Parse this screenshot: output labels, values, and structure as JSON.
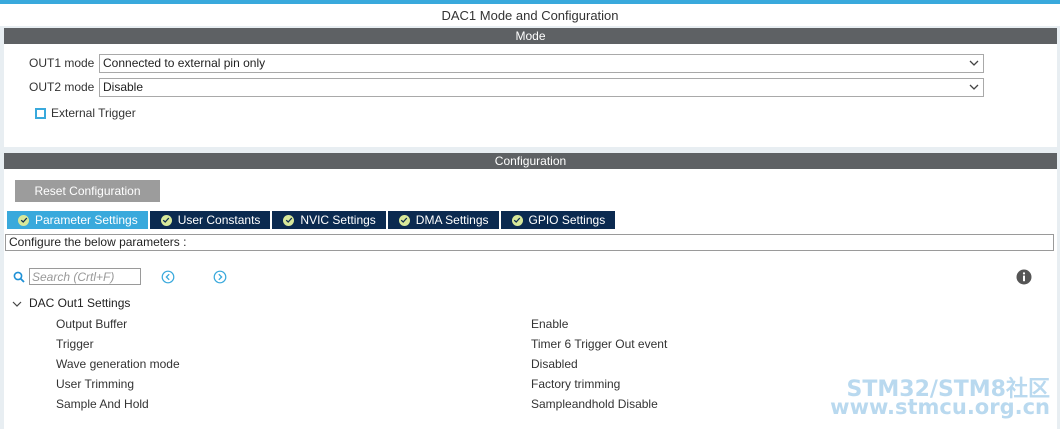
{
  "window": {
    "title": "DAC1 Mode and Configuration"
  },
  "mode_section": {
    "title": "Mode",
    "out1": {
      "label": "OUT1 mode",
      "value": "Connected to external pin only"
    },
    "out2": {
      "label": "OUT2 mode",
      "value": "Disable"
    },
    "external_trigger": {
      "label": "External Trigger",
      "checked": false
    }
  },
  "config_section": {
    "title": "Configuration",
    "reset_label": "Reset Configuration",
    "tabs": [
      {
        "label": "Parameter Settings",
        "active": true
      },
      {
        "label": "User Constants",
        "active": false
      },
      {
        "label": "NVIC Settings",
        "active": false
      },
      {
        "label": "DMA Settings",
        "active": false
      },
      {
        "label": "GPIO Settings",
        "active": false
      }
    ],
    "description": "Configure the below parameters :",
    "search": {
      "placeholder": "Search (Crtl+F)"
    },
    "icons": {
      "search": "search-icon",
      "prev": "arrow-left-circle-icon",
      "next": "arrow-right-circle-icon",
      "info": "info-icon"
    },
    "group": {
      "label": "DAC Out1 Settings",
      "params": [
        {
          "name": "Output Buffer",
          "value": "Enable"
        },
        {
          "name": "Trigger",
          "value": "Timer 6 Trigger Out event"
        },
        {
          "name": "Wave generation mode",
          "value": "Disabled"
        },
        {
          "name": "User Trimming",
          "value": "Factory trimming"
        },
        {
          "name": "Sample And Hold",
          "value": "Sampleandhold Disable"
        }
      ]
    }
  },
  "watermark": {
    "line1": "STM32/STM8社区",
    "line2": "www.stmcu.org.cn"
  },
  "colors": {
    "accent": "#39a9dc",
    "tab_bg": "#0b2a50",
    "section_bar": "#5e6164",
    "button_gray": "#9c9c9c"
  }
}
